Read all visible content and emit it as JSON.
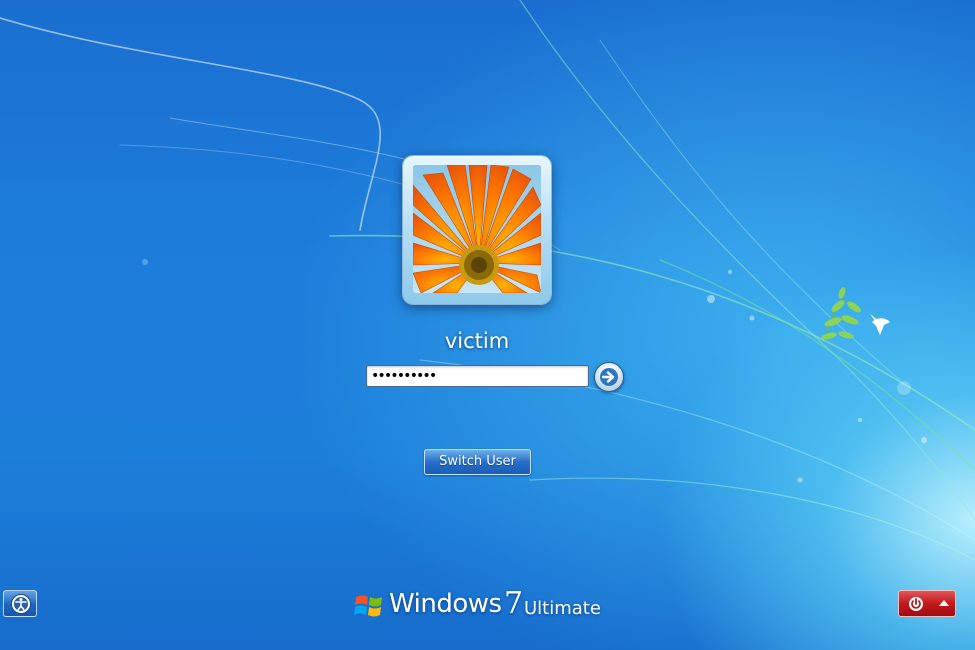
{
  "login": {
    "username": "victim",
    "password_masked": "••••••••••",
    "user_picture_icon": "orange-gerbera-flower"
  },
  "buttons": {
    "submit_icon": "arrow-right-icon",
    "switch_user_label": "Switch User",
    "ease_of_access_icon": "ease-of-access-icon",
    "power_icon": "power-icon",
    "power_options_icon": "chevron-up-icon"
  },
  "branding": {
    "logo_icon": "windows-flag-icon",
    "product_name": "Windows",
    "version": "7",
    "edition": "Ultimate"
  },
  "colors": {
    "background": "#1d7ddb",
    "power_button": "#c21a1d",
    "switch_user_button": "#2a6fc4"
  }
}
